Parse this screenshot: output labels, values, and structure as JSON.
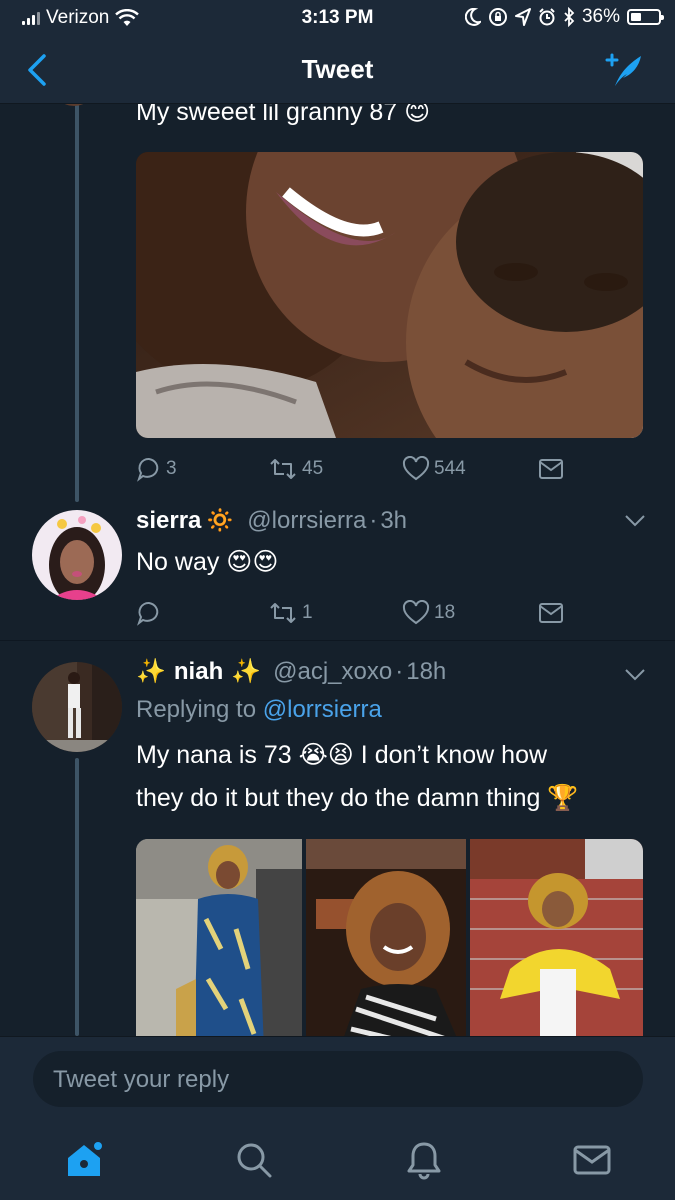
{
  "status_bar": {
    "carrier": "Verizon",
    "time": "3:13 PM",
    "battery": "36%",
    "battery_level": 0.36
  },
  "nav": {
    "title": "Tweet"
  },
  "main_tweet": {
    "text": "My sweeet lil granny 87 😊",
    "image_alt": "selfie with grandmother",
    "reply_count": "3",
    "retweet_count": "45",
    "like_count": "544"
  },
  "reply_1": {
    "name": "sierra",
    "name_emoji": "🔅",
    "handle": "@lorrsierra",
    "separator": "·",
    "time": "3h",
    "text": "No way 😍😍",
    "reply_count": "",
    "retweet_count": "1",
    "like_count": "18"
  },
  "reply_2": {
    "name_prefix": "✨",
    "name": "niah",
    "name_suffix": "✨",
    "handle": "@acj_xoxo",
    "separator": "·",
    "time": "18h",
    "replying_to_label": "Replying to",
    "replying_to_handle": "@lorrsierra",
    "text_line_1": "My nana is 73 😭😫 I don’t know how",
    "text_line_2": "they do it but they do the damn thing 🏆"
  },
  "reply_box": {
    "placeholder": "Tweet your reply"
  },
  "tab_bar": {
    "items": [
      "home-icon",
      "search-icon",
      "notifications-icon",
      "messages-icon"
    ],
    "active": "home-icon"
  },
  "colors": {
    "background": "#15202b",
    "bar": "#1c2938",
    "accent": "#1da1f2",
    "muted": "#8899a6"
  }
}
